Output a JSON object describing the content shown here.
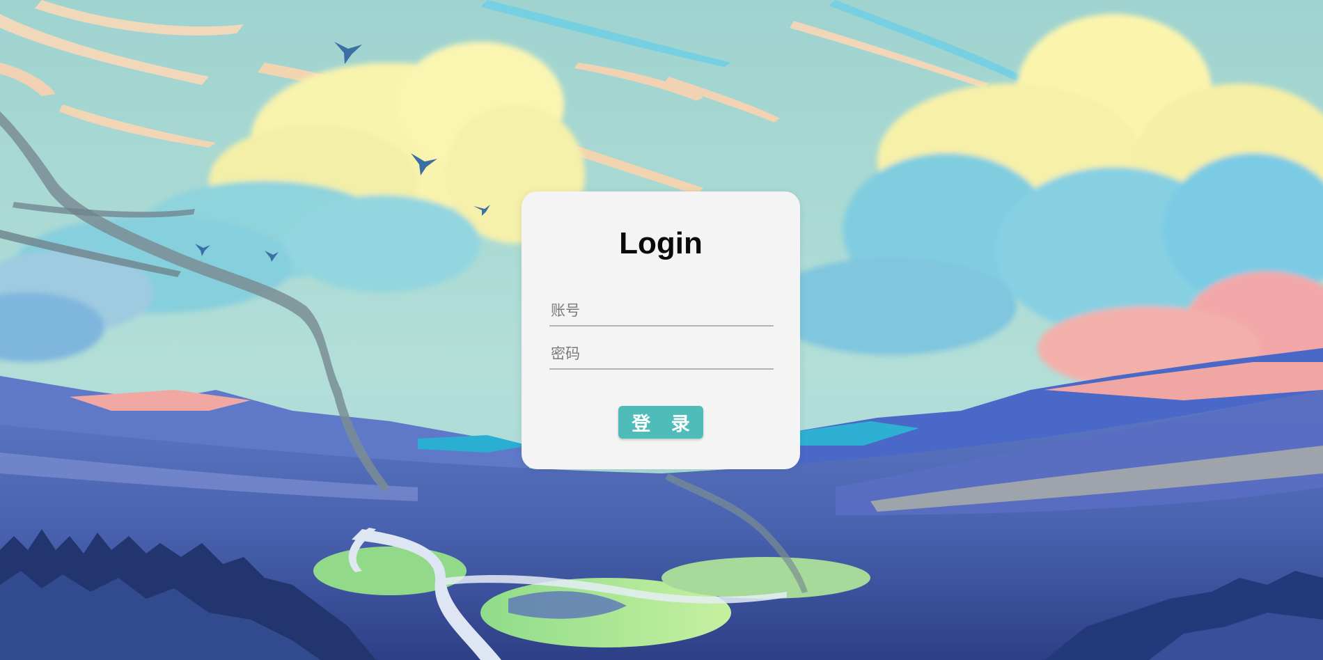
{
  "login": {
    "title": "Login",
    "account_placeholder": "账号",
    "password_placeholder": "密码",
    "submit_label": "登 录"
  },
  "colors": {
    "card_background": "#f4f4f4",
    "button_background": "#4fbcb9",
    "button_text": "#ffffff",
    "title_text": "#0a0a0a",
    "field_underline": "#b3b3b3"
  }
}
